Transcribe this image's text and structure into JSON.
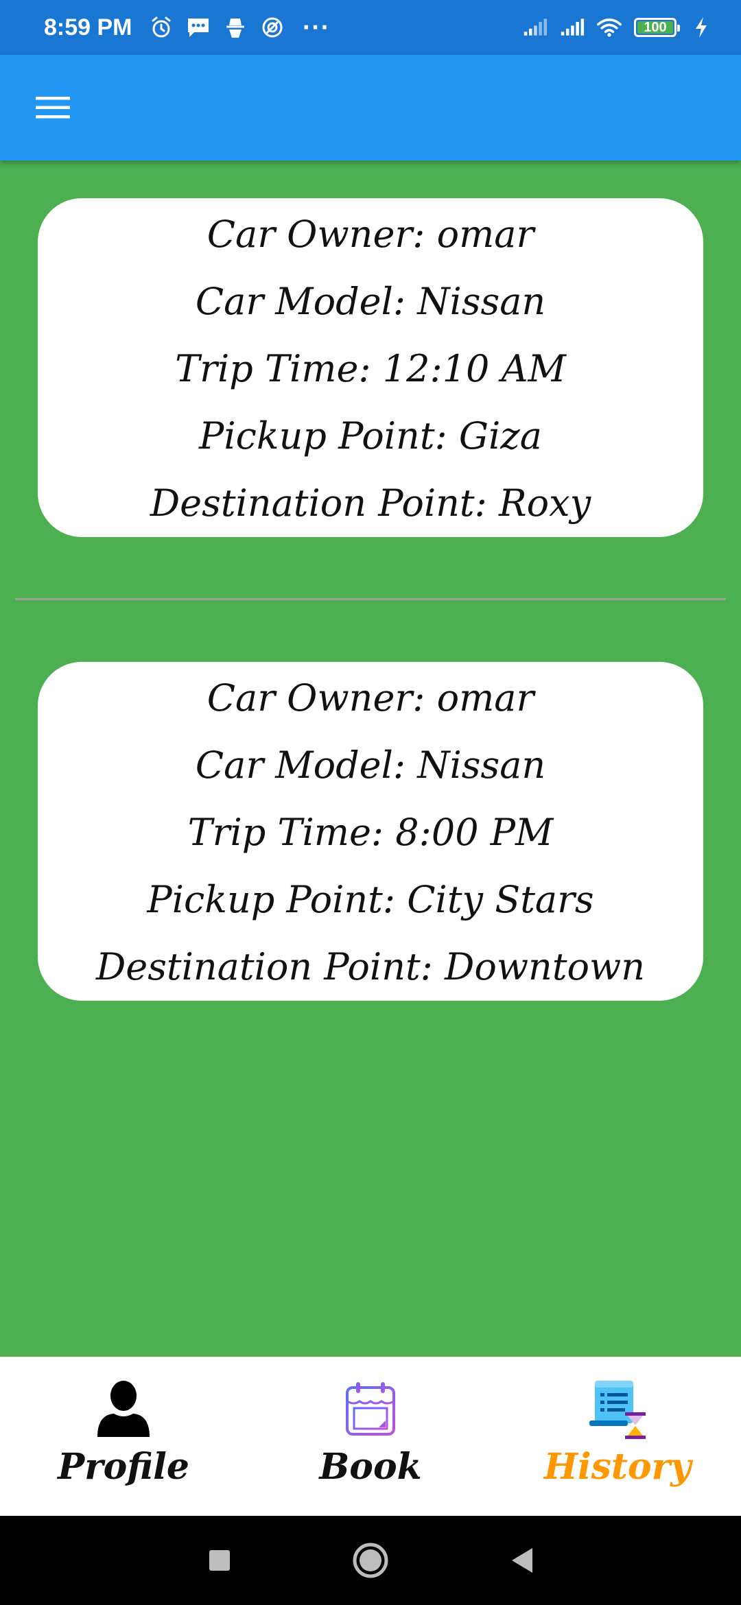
{
  "status_bar": {
    "time": "8:59 PM",
    "battery": "100",
    "icons": [
      "alarm-icon",
      "message-icon",
      "incognito-icon",
      "vpn-icon",
      "more-dots-icon",
      "signal-icon",
      "signal-icon",
      "wifi-icon",
      "battery-icon",
      "charging-icon"
    ],
    "more": "···"
  },
  "app_bar": {
    "menu_icon": "hamburger-menu-icon"
  },
  "trips": [
    {
      "owner": "Car Owner: omar",
      "model": "Car Model: Nissan",
      "time": "Trip Time: 12:10 AM",
      "pickup": "Pickup Point: Giza",
      "destination": "Destination Point: Roxy"
    },
    {
      "owner": "Car Owner: omar",
      "model": "Car Model: Nissan",
      "time": "Trip Time: 8:00 PM",
      "pickup": "Pickup Point: City Stars",
      "destination": "Destination Point: Downtown"
    }
  ],
  "bottom_nav": {
    "items": [
      {
        "label": "Profile",
        "icon": "person-icon"
      },
      {
        "label": "Book",
        "icon": "calendar-icon"
      },
      {
        "label": "History",
        "icon": "history-icon"
      }
    ],
    "active": "History"
  },
  "colors": {
    "status_bar": "#1976d2",
    "app_bar": "#2196f3",
    "background": "#4caf50",
    "card": "#ffffff",
    "active_tab": "#ff9800"
  }
}
